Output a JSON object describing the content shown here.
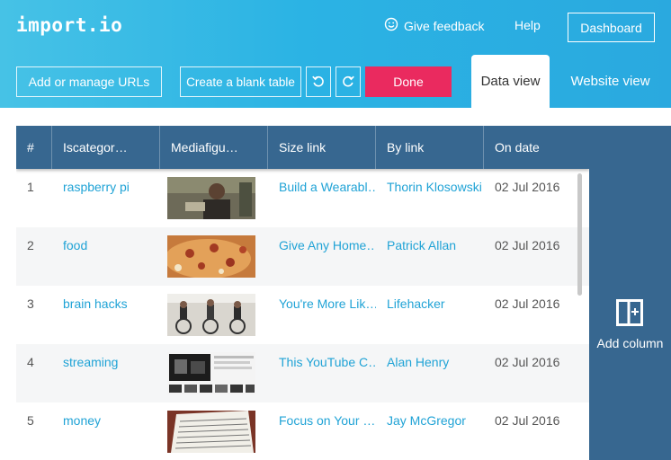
{
  "app": {
    "logo": "import.io"
  },
  "header": {
    "feedback_label": "Give feedback",
    "help_label": "Help",
    "dashboard_label": "Dashboard"
  },
  "toolbar": {
    "add_urls_label": "Add or manage URLs",
    "blank_table_label": "Create a blank table",
    "undo_icon": "undo-icon",
    "redo_icon": "redo-icon",
    "done_label": "Done"
  },
  "tabs": [
    {
      "label": "Data view",
      "active": true
    },
    {
      "label": "Website view",
      "active": false
    }
  ],
  "table": {
    "columns": [
      "#",
      "Iscategor…",
      "Mediafigu…",
      "Size link",
      "By link",
      "On date"
    ],
    "rows": [
      {
        "num": "1",
        "category": "raspberry pi",
        "image": "image-thumbnail",
        "size_link": "Build a Wearabl…",
        "by_link": "Thorin Klosowski",
        "date": "02 Jul 2016"
      },
      {
        "num": "2",
        "category": "food",
        "image": "image-thumbnail",
        "size_link": "Give Any Home…",
        "by_link": "Patrick Allan",
        "date": "02 Jul 2016"
      },
      {
        "num": "3",
        "category": "brain hacks",
        "image": "image-thumbnail",
        "size_link": "You're More Lik…",
        "by_link": "Lifehacker",
        "date": "02 Jul 2016"
      },
      {
        "num": "4",
        "category": "streaming",
        "image": "image-thumbnail",
        "size_link": "This YouTube C…",
        "by_link": "Alan Henry",
        "date": "02 Jul 2016"
      },
      {
        "num": "5",
        "category": "money",
        "image": "image-thumbnail",
        "size_link": "Focus on Your …",
        "by_link": "Jay McGregor",
        "date": "02 Jul 2016"
      }
    ]
  },
  "add_column": {
    "label": "Add column",
    "icon": "add-column-icon"
  },
  "colors": {
    "header_gradient": "#2bb3e4",
    "done_button": "#ea2a5f",
    "table_header": "#376790",
    "link": "#20a3d6"
  }
}
